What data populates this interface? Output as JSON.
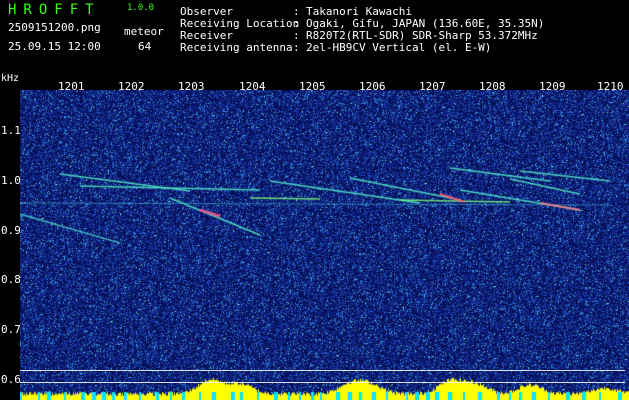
{
  "header": {
    "app_name": "HROFFT",
    "version": "1.0.0",
    "filename": "2509151200.png",
    "detection_type": "meteor",
    "datetime": "25.09.15 12:00",
    "count": "64"
  },
  "info": {
    "labels": [
      "Observer",
      "Receiving Location",
      "Receiver",
      "Receiving antenna"
    ],
    "values": [
      "Takanori Kawachi",
      "Ogaki, Gifu, JAPAN (136.60E, 35.35N)",
      "R820T2(RTL-SDR) SDR-Sharp 53.372MHz",
      "2el-HB9CV Vertical (el. E-W)"
    ]
  },
  "axes": {
    "y_unit": "kHz",
    "y_ticks": [
      "1.1",
      "1.0",
      "0.9",
      "0.8",
      "0.7",
      "0.6"
    ],
    "x_ticks": [
      "1201",
      "1202",
      "1203",
      "1204",
      "1205",
      "1206",
      "1207",
      "1208",
      "1209",
      "1210"
    ]
  },
  "colors": {
    "label": "#39ff14",
    "text": "#ffffff",
    "background_noise": "#0a1a7a",
    "intensity_bar": "#ffff00"
  }
}
